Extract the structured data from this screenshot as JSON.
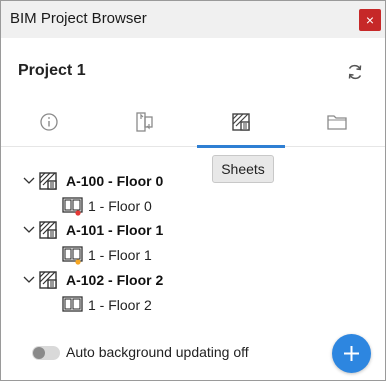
{
  "window": {
    "title": "BIM Project Browser",
    "close_label": "×"
  },
  "project": {
    "title": "Project 1"
  },
  "tabs": [
    {
      "name": "info",
      "icon": "info-icon",
      "active": false
    },
    {
      "name": "views",
      "icon": "transfer-views-icon",
      "active": false
    },
    {
      "name": "sheets",
      "icon": "sheet-icon",
      "active": true
    },
    {
      "name": "files",
      "icon": "folder-icon",
      "active": false
    }
  ],
  "tooltip": {
    "text": "Sheets"
  },
  "tree": [
    {
      "sheet": "A-100 - Floor 0",
      "view": "1 - Floor 0",
      "status_color": "#e53935"
    },
    {
      "sheet": "A-101 - Floor 1",
      "view": "1 - Floor 1",
      "status_color": "#f5a623"
    },
    {
      "sheet": "A-102 - Floor 2",
      "view": "1 - Floor 2",
      "status_color": null
    }
  ],
  "footer": {
    "toggle_label": "Auto background updating off",
    "toggle_on": false
  },
  "colors": {
    "accent": "#2f7fd3",
    "close": "#c62828",
    "fab": "#2d86e0"
  }
}
